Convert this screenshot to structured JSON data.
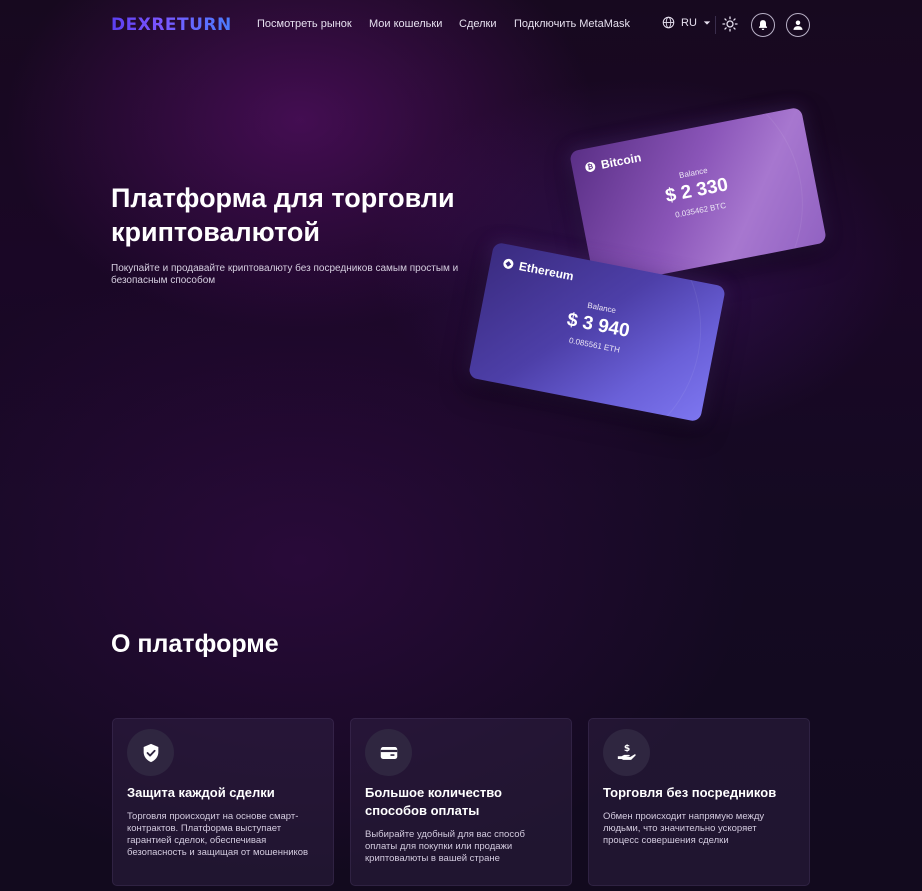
{
  "header": {
    "logo": "DEXRETURN",
    "nav": [
      {
        "label": "Посмотреть рынок"
      },
      {
        "label": "Мои кошельки"
      },
      {
        "label": "Сделки"
      },
      {
        "label": "Подключить MetaMask"
      }
    ],
    "language": "RU"
  },
  "hero": {
    "title_line1": "Платформа для торговли",
    "title_line2": "криптовалютой",
    "subtitle": "Покупайте и продавайте криптовалюту без посредников самым простым и безопасным способом"
  },
  "cards": {
    "bitcoin": {
      "name": "Bitcoin",
      "balance_label": "Balance",
      "amount": "$ 2 330",
      "crypto": "0.035462 BTC"
    },
    "ethereum": {
      "name": "Ethereum",
      "balance_label": "Balance",
      "amount": "$ 3 940",
      "crypto": "0.085561 ETH"
    }
  },
  "about": {
    "title": "О платформе",
    "features": [
      {
        "icon": "shield-check-icon",
        "title": "Защита каждой сделки",
        "text": "Торговля происходит на основе смарт-контрактов. Платформа выступает гарантией сделок, обеспечивая безопасность и защищая от мошенников"
      },
      {
        "icon": "credit-card-icon",
        "title": "Большое количество способов оплаты",
        "text": "Выбирайте удобный для вас способ оплаты для покупки или продажи криптовалюты в вашей стране"
      },
      {
        "icon": "hand-dollar-icon",
        "title": "Торговля без посредников",
        "text": "Обмен происходит напрямую между людьми, что значительно ускоряет процесс совершения сделки"
      }
    ]
  }
}
